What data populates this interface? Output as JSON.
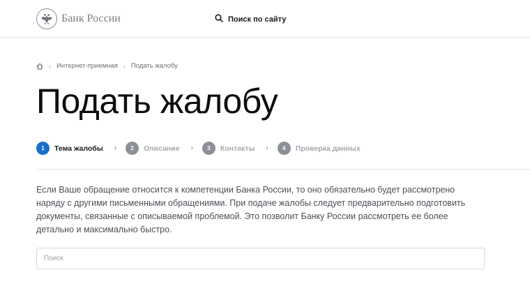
{
  "header": {
    "logo_text": "Банк России",
    "logo_icon": "eagle-emblem-icon",
    "search_label": "Поиск по сайту",
    "search_icon": "search-icon"
  },
  "breadcrumb": {
    "home_icon": "home-icon",
    "items": [
      "Интернет-приемная",
      "Подать жалобу"
    ]
  },
  "page": {
    "title": "Подать жалобу",
    "description": "Если Ваше обращение относится к компетенции Банка России, то оно обязательно будет рассмотрено наряду с другими письменными обращениями. При подаче жалобы следует предварительно подготовить документы, связанные с описываемой проблемой. Это позволит Банку России рассмотреть ее более детально и максимально быстро."
  },
  "stepper": {
    "active_color": "#1a6fc9",
    "inactive_color": "#8d9098",
    "steps": [
      {
        "number": "1",
        "label": "Тема жалобы"
      },
      {
        "number": "2",
        "label": "Описание"
      },
      {
        "number": "3",
        "label": "Контакты"
      },
      {
        "number": "4",
        "label": "Проверка данных"
      }
    ]
  },
  "search": {
    "placeholder": "Поиск",
    "value": ""
  }
}
